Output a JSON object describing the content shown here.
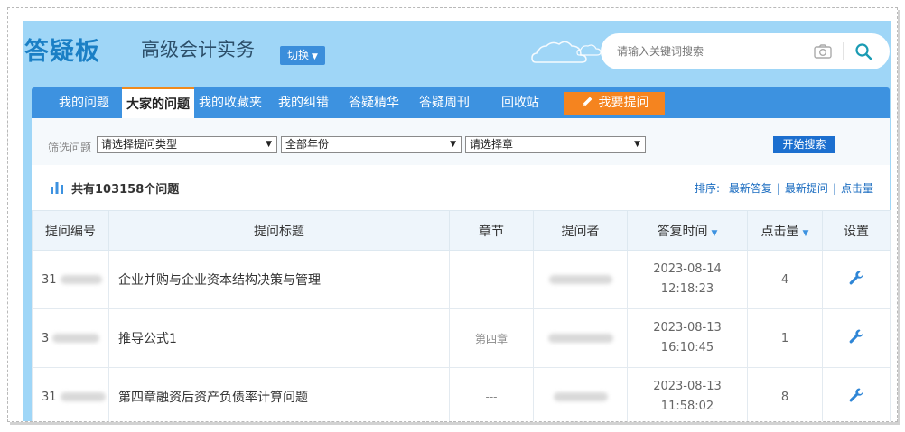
{
  "header": {
    "logo": "答疑板",
    "course": "高级会计实务",
    "switch_label": "切换"
  },
  "search": {
    "placeholder": "请输入关键词搜索"
  },
  "nav": {
    "items": [
      {
        "label": "我的问题"
      },
      {
        "label": "大家的问题",
        "active": true
      },
      {
        "label": "我的收藏夹"
      },
      {
        "label": "我的纠错"
      },
      {
        "label": "答疑精华"
      },
      {
        "label": "答疑周刊"
      },
      {
        "label": "回收站"
      }
    ],
    "ask_label": "我要提问"
  },
  "filter": {
    "label": "筛选问题",
    "type_select": "请选择提问类型",
    "year_select": "全部年份",
    "chapter_select": "请选择章",
    "search_button": "开始搜索"
  },
  "summary": {
    "total": "共有103158个问题"
  },
  "sort": {
    "label": "排序:",
    "options": [
      "最新答复",
      "最新提问",
      "点击量"
    ]
  },
  "table": {
    "headers": [
      "提问编号",
      "提问标题",
      "章节",
      "提问者",
      "答复时间",
      "点击量",
      "设置"
    ],
    "rows": [
      {
        "id": "31",
        "title": "企业并购与企业资本结构决策与管理",
        "chapter": "---",
        "date": "2023-08-14",
        "time": "12:18:23",
        "clicks": "4"
      },
      {
        "id": "3",
        "title": "推导公式1",
        "chapter": "第四章",
        "date": "2023-08-13",
        "time": "16:10:45",
        "clicks": "1"
      },
      {
        "id": "31",
        "title": "第四章融资后资产负债率计算问题",
        "chapter": "---",
        "date": "2023-08-13",
        "time": "11:58:02",
        "clicks": "8"
      }
    ]
  },
  "colors": {
    "background": "#9fd6f7",
    "nav": "#3d92e0",
    "accent": "#f5841f",
    "link": "#1a6cc0"
  },
  "icons": [
    "camera-icon",
    "search-icon",
    "pencil-icon",
    "bar-chart-icon",
    "wrench-icon",
    "cloud-icon"
  ]
}
